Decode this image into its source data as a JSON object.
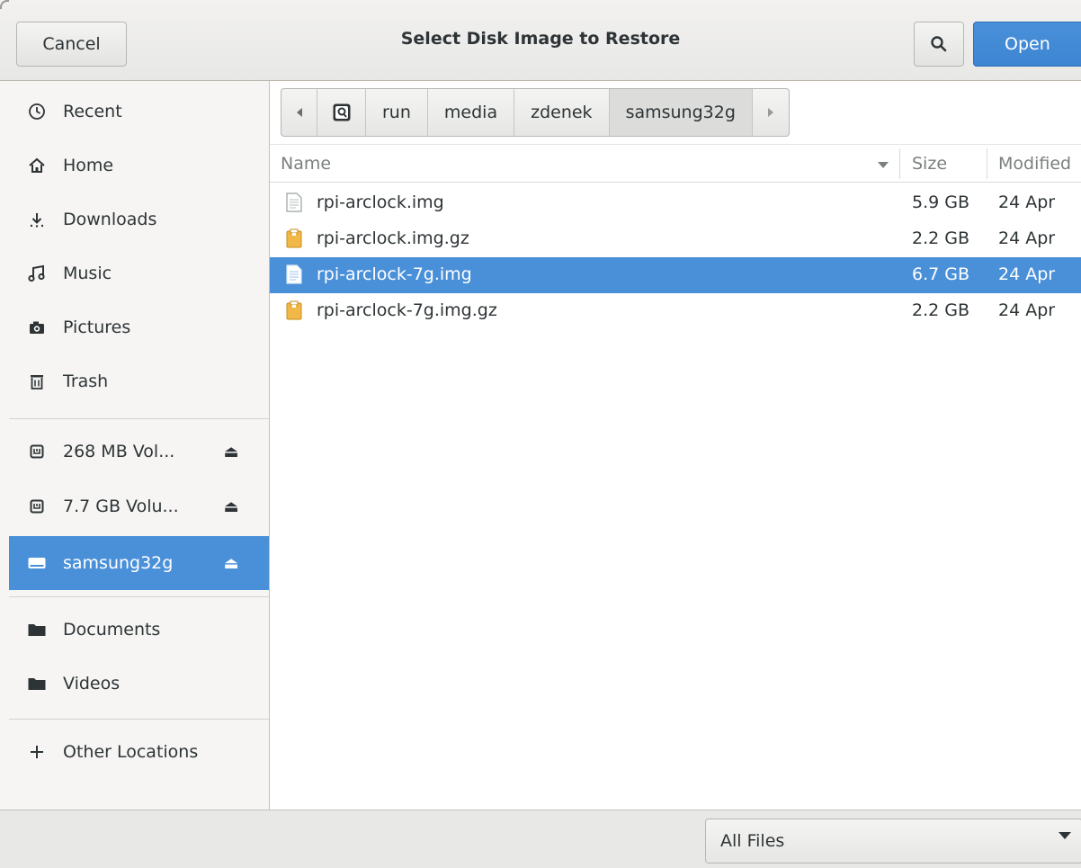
{
  "header": {
    "title": "Select Disk Image to Restore",
    "cancel_label": "Cancel",
    "open_label": "Open",
    "search_icon": "search-icon"
  },
  "sidebar": {
    "places": [
      {
        "label": "Recent",
        "icon": "clock-icon"
      },
      {
        "label": "Home",
        "icon": "home-icon"
      },
      {
        "label": "Downloads",
        "icon": "download-icon"
      },
      {
        "label": "Music",
        "icon": "music-icon"
      },
      {
        "label": "Pictures",
        "icon": "camera-icon"
      },
      {
        "label": "Trash",
        "icon": "trash-icon"
      }
    ],
    "devices": [
      {
        "label": "268 MB Vol...",
        "icon": "drive-icon",
        "eject": "⏏"
      },
      {
        "label": "7.7 GB Volu...",
        "icon": "drive-icon",
        "eject": "⏏"
      },
      {
        "label": "samsung32g",
        "icon": "drive-icon",
        "eject": "⏏",
        "selected": true
      }
    ],
    "bookmarks": [
      {
        "label": "Documents",
        "icon": "folder-icon"
      },
      {
        "label": "Videos",
        "icon": "folder-icon"
      }
    ],
    "other": {
      "label": "Other Locations",
      "icon": "plus-icon"
    }
  },
  "pathbar": {
    "crumbs": [
      "run",
      "media",
      "zdenek",
      "samsung32g"
    ]
  },
  "filelist": {
    "columns": {
      "name": "Name",
      "size": "Size",
      "modified": "Modified"
    },
    "rows": [
      {
        "name": "rpi-arclock.img",
        "size": "5.9 GB",
        "modified": "24 Apr",
        "type": "file"
      },
      {
        "name": "rpi-arclock.img.gz",
        "size": "2.2 GB",
        "modified": "24 Apr",
        "type": "archive"
      },
      {
        "name": "rpi-arclock-7g.img",
        "size": "6.7 GB",
        "modified": "24 Apr",
        "type": "file",
        "selected": true
      },
      {
        "name": "rpi-arclock-7g.img.gz",
        "size": "2.2 GB",
        "modified": "24 Apr",
        "type": "archive"
      }
    ]
  },
  "filter": {
    "selected": "All Files"
  },
  "colors": {
    "accent": "#4a90d9",
    "sidebar_bg": "#f6f5f4",
    "header_bg": "#e8e8e7"
  }
}
